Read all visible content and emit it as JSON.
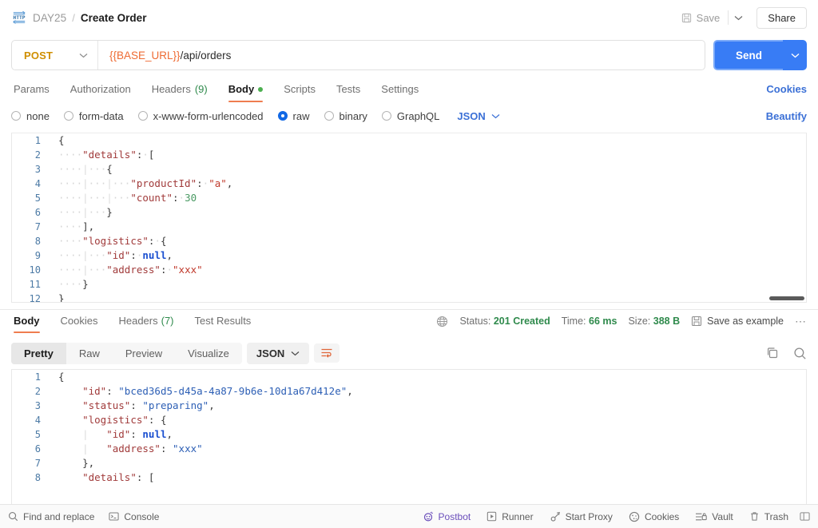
{
  "header": {
    "http_icon": "http-protocol-icon",
    "collection": "DAY25",
    "separator": "/",
    "request_name": "Create Order",
    "save_label": "Save",
    "save_icon": "floppy-disk-icon",
    "save_caret_icon": "chevron-down-icon",
    "share_label": "Share"
  },
  "url_bar": {
    "method": "POST",
    "method_caret_icon": "chevron-down-icon",
    "url_variable": "{{BASE_URL}}",
    "url_path": "/api/orders",
    "send_label": "Send",
    "send_caret_icon": "chevron-down-icon"
  },
  "request_tabs": {
    "items": [
      {
        "label": "Params",
        "count": "",
        "active": false,
        "dot": false
      },
      {
        "label": "Authorization",
        "count": "",
        "active": false,
        "dot": false
      },
      {
        "label": "Headers",
        "count": "(9)",
        "active": false,
        "dot": false
      },
      {
        "label": "Body",
        "count": "",
        "active": true,
        "dot": true
      },
      {
        "label": "Scripts",
        "count": "",
        "active": false,
        "dot": false
      },
      {
        "label": "Tests",
        "count": "",
        "active": false,
        "dot": false
      },
      {
        "label": "Settings",
        "count": "",
        "active": false,
        "dot": false
      }
    ],
    "cookies_label": "Cookies"
  },
  "body_modes": {
    "options": [
      {
        "label": "none",
        "checked": false
      },
      {
        "label": "form-data",
        "checked": false
      },
      {
        "label": "x-www-form-urlencoded",
        "checked": false
      },
      {
        "label": "raw",
        "checked": true
      },
      {
        "label": "binary",
        "checked": false
      },
      {
        "label": "GraphQL",
        "checked": false
      }
    ],
    "format": "JSON",
    "format_caret_icon": "chevron-down-icon",
    "beautify_label": "Beautify"
  },
  "request_body": {
    "lines": [
      {
        "num": "1",
        "tokens": [
          {
            "t": "{",
            "c": "p"
          }
        ]
      },
      {
        "num": "2",
        "tokens": [
          {
            "t": "····",
            "c": "ws"
          },
          {
            "t": "\"details\"",
            "c": "k"
          },
          {
            "t": ":",
            "c": "p"
          },
          {
            "t": "·",
            "c": "ws"
          },
          {
            "t": "[",
            "c": "p"
          }
        ]
      },
      {
        "num": "3",
        "tokens": [
          {
            "t": "····",
            "c": "ws"
          },
          {
            "t": "|",
            "c": "guide"
          },
          {
            "t": "···",
            "c": "ws"
          },
          {
            "t": "{",
            "c": "p"
          }
        ]
      },
      {
        "num": "4",
        "tokens": [
          {
            "t": "····",
            "c": "ws"
          },
          {
            "t": "|",
            "c": "guide"
          },
          {
            "t": "···",
            "c": "ws"
          },
          {
            "t": "|",
            "c": "guide"
          },
          {
            "t": "···",
            "c": "ws"
          },
          {
            "t": "\"productId\"",
            "c": "k"
          },
          {
            "t": ":",
            "c": "p"
          },
          {
            "t": "·",
            "c": "ws"
          },
          {
            "t": "\"a\"",
            "c": "s"
          },
          {
            "t": ",",
            "c": "p"
          }
        ]
      },
      {
        "num": "5",
        "tokens": [
          {
            "t": "····",
            "c": "ws"
          },
          {
            "t": "|",
            "c": "guide"
          },
          {
            "t": "···",
            "c": "ws"
          },
          {
            "t": "|",
            "c": "guide"
          },
          {
            "t": "···",
            "c": "ws"
          },
          {
            "t": "\"count\"",
            "c": "k"
          },
          {
            "t": ":",
            "c": "p"
          },
          {
            "t": "·",
            "c": "ws"
          },
          {
            "t": "30",
            "c": "n"
          }
        ]
      },
      {
        "num": "6",
        "tokens": [
          {
            "t": "····",
            "c": "ws"
          },
          {
            "t": "|",
            "c": "guide"
          },
          {
            "t": "···",
            "c": "ws"
          },
          {
            "t": "}",
            "c": "p"
          }
        ]
      },
      {
        "num": "7",
        "tokens": [
          {
            "t": "····",
            "c": "ws"
          },
          {
            "t": "]",
            "c": "p"
          },
          {
            "t": ",",
            "c": "p"
          }
        ]
      },
      {
        "num": "8",
        "tokens": [
          {
            "t": "····",
            "c": "ws"
          },
          {
            "t": "\"logistics\"",
            "c": "k"
          },
          {
            "t": ":",
            "c": "p"
          },
          {
            "t": "·",
            "c": "ws"
          },
          {
            "t": "{",
            "c": "p"
          }
        ]
      },
      {
        "num": "9",
        "tokens": [
          {
            "t": "····",
            "c": "ws"
          },
          {
            "t": "|",
            "c": "guide"
          },
          {
            "t": "···",
            "c": "ws"
          },
          {
            "t": "\"id\"",
            "c": "k"
          },
          {
            "t": ":",
            "c": "p"
          },
          {
            "t": "·",
            "c": "ws"
          },
          {
            "t": "null",
            "c": "nul"
          },
          {
            "t": ",",
            "c": "p"
          }
        ]
      },
      {
        "num": "10",
        "tokens": [
          {
            "t": "····",
            "c": "ws"
          },
          {
            "t": "|",
            "c": "guide"
          },
          {
            "t": "···",
            "c": "ws"
          },
          {
            "t": "\"address\"",
            "c": "k"
          },
          {
            "t": ":",
            "c": "p"
          },
          {
            "t": "·",
            "c": "ws"
          },
          {
            "t": "\"xxx\"",
            "c": "s"
          }
        ]
      },
      {
        "num": "11",
        "tokens": [
          {
            "t": "····",
            "c": "ws"
          },
          {
            "t": "}",
            "c": "p"
          }
        ]
      },
      {
        "num": "12",
        "tokens": [
          {
            "t": "}",
            "c": "p"
          }
        ]
      }
    ]
  },
  "response_tabs": {
    "items": [
      {
        "label": "Body",
        "count": "",
        "active": true
      },
      {
        "label": "Cookies",
        "count": "",
        "active": false
      },
      {
        "label": "Headers",
        "count": "(7)",
        "active": false
      },
      {
        "label": "Test Results",
        "count": "",
        "active": false
      }
    ],
    "globe_icon": "globe-icon",
    "status_label": "Status:",
    "status_value": "201 Created",
    "time_label": "Time:",
    "time_value": "66 ms",
    "size_label": "Size:",
    "size_value": "388 B",
    "save_example_label": "Save as example",
    "save_example_icon": "floppy-disk-icon",
    "more_icon": "ellipsis-icon"
  },
  "response_toolbar": {
    "segments": [
      {
        "label": "Pretty",
        "active": true
      },
      {
        "label": "Raw",
        "active": false
      },
      {
        "label": "Preview",
        "active": false
      },
      {
        "label": "Visualize",
        "active": false
      }
    ],
    "format": "JSON",
    "format_caret_icon": "chevron-down-icon",
    "wrap_icon": "word-wrap-icon",
    "copy_icon": "copy-icon",
    "search_icon": "search-icon"
  },
  "response_body": {
    "lines": [
      {
        "num": "1",
        "tokens": [
          {
            "t": "{",
            "c": "p"
          }
        ]
      },
      {
        "num": "2",
        "tokens": [
          {
            "t": "    ",
            "c": "p"
          },
          {
            "t": "\"id\"",
            "c": "k"
          },
          {
            "t": ": ",
            "c": "p"
          },
          {
            "t": "\"bced36d5-d45a-4a87-9b6e-10d1a67d412e\"",
            "c": "sb"
          },
          {
            "t": ",",
            "c": "p"
          }
        ]
      },
      {
        "num": "3",
        "tokens": [
          {
            "t": "    ",
            "c": "p"
          },
          {
            "t": "\"status\"",
            "c": "k"
          },
          {
            "t": ": ",
            "c": "p"
          },
          {
            "t": "\"preparing\"",
            "c": "sb"
          },
          {
            "t": ",",
            "c": "p"
          }
        ]
      },
      {
        "num": "4",
        "tokens": [
          {
            "t": "    ",
            "c": "p"
          },
          {
            "t": "\"logistics\"",
            "c": "k"
          },
          {
            "t": ": ",
            "c": "p"
          },
          {
            "t": "{",
            "c": "p"
          }
        ]
      },
      {
        "num": "5",
        "tokens": [
          {
            "t": "    ",
            "c": "p"
          },
          {
            "t": "|",
            "c": "guide"
          },
          {
            "t": "   ",
            "c": "p"
          },
          {
            "t": "\"id\"",
            "c": "k"
          },
          {
            "t": ": ",
            "c": "p"
          },
          {
            "t": "null",
            "c": "nul"
          },
          {
            "t": ",",
            "c": "p"
          }
        ]
      },
      {
        "num": "6",
        "tokens": [
          {
            "t": "    ",
            "c": "p"
          },
          {
            "t": "|",
            "c": "guide"
          },
          {
            "t": "   ",
            "c": "p"
          },
          {
            "t": "\"address\"",
            "c": "k"
          },
          {
            "t": ": ",
            "c": "p"
          },
          {
            "t": "\"xxx\"",
            "c": "sb"
          }
        ]
      },
      {
        "num": "7",
        "tokens": [
          {
            "t": "    ",
            "c": "p"
          },
          {
            "t": "},",
            "c": "p"
          }
        ]
      },
      {
        "num": "8",
        "tokens": [
          {
            "t": "    ",
            "c": "p"
          },
          {
            "t": "\"details\"",
            "c": "k"
          },
          {
            "t": ": ",
            "c": "p"
          },
          {
            "t": "[",
            "c": "p"
          }
        ]
      }
    ]
  },
  "footer": {
    "left": [
      {
        "label": "Find and replace",
        "icon": "search-icon"
      },
      {
        "label": "Console",
        "icon": "console-icon"
      }
    ],
    "right": [
      {
        "label": "Postbot",
        "icon": "postbot-icon"
      },
      {
        "label": "Runner",
        "icon": "play-icon"
      },
      {
        "label": "Start Proxy",
        "icon": "proxy-icon"
      },
      {
        "label": "Cookies",
        "icon": "cookie-icon"
      },
      {
        "label": "Vault",
        "icon": "vault-lock-icon"
      },
      {
        "label": "Trash",
        "icon": "trash-icon"
      }
    ],
    "edge_icon": "panel-toggle-icon"
  },
  "colors": {
    "accent_blue": "#387cf5",
    "tab_underline": "#ef7d4f",
    "status_green": "#2f8a4c",
    "method_orange": "#cf8e00",
    "var_orange": "#ee6b33",
    "postbot_purple": "#6b4fbb"
  }
}
